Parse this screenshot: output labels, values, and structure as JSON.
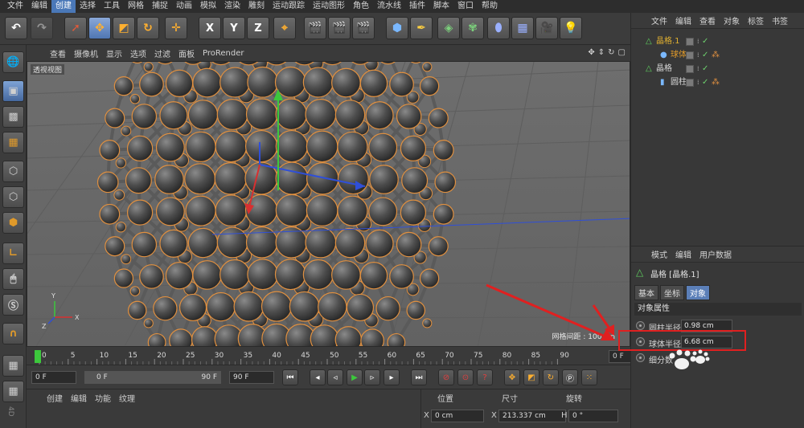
{
  "menubar": [
    "文件",
    "编辑",
    "创建",
    "选择",
    "工具",
    "网格",
    "捕捉",
    "动画",
    "模拟",
    "渲染",
    "雕刻",
    "运动跟踪",
    "运动图形",
    "角色",
    "流水线",
    "插件",
    "脚本",
    "窗口",
    "帮助"
  ],
  "menubar_active_index": 2,
  "toolbar": {
    "x_label": "X",
    "y_label": "Y",
    "z_label": "Z"
  },
  "viewport": {
    "menu": [
      "查看",
      "摄像机",
      "显示",
      "选项",
      "过滤",
      "面板",
      "ProRender"
    ],
    "view_label": "透视视图",
    "grid_info": "网格间距 : 100 cm"
  },
  "timeline": {
    "ticks": [
      "0",
      "5",
      "10",
      "15",
      "20",
      "25",
      "30",
      "35",
      "40",
      "45",
      "50",
      "55",
      "60",
      "65",
      "70",
      "75",
      "80",
      "85",
      "90"
    ],
    "current_frame": "0 F"
  },
  "playback": {
    "start": "0 F",
    "range_start": "0 F",
    "range_end": "90 F",
    "end": "90 F"
  },
  "bottom_tabs": [
    "创建",
    "编辑",
    "功能",
    "纹理"
  ],
  "coords": {
    "headers": [
      "位置",
      "尺寸",
      "旋转"
    ],
    "x_label": "X",
    "x_value": "0 cm",
    "size_label": "X",
    "size_value": "213.337 cm",
    "h_label": "H",
    "h_value": "0 °"
  },
  "object_manager": {
    "menu": [
      "文件",
      "编辑",
      "查看",
      "对象",
      "标签",
      "书签"
    ],
    "objects": [
      {
        "name": "晶格.1",
        "color": "#e0b030"
      },
      {
        "name": "球体",
        "color": "#e09a2a"
      },
      {
        "name": "晶格",
        "color": "#d8d8d8"
      },
      {
        "name": "圆柱",
        "color": "#d8d8d8"
      }
    ]
  },
  "attribute_manager": {
    "menu": [
      "模式",
      "编辑",
      "用户数据"
    ],
    "title": "晶格 [晶格.1]",
    "tabs": [
      "基本",
      "坐标",
      "对象"
    ],
    "section": "对象属性",
    "fields": [
      {
        "label": "圆柱半径",
        "value": "0.98 cm"
      },
      {
        "label": "球体半径",
        "value": "6.68 cm"
      },
      {
        "label": "细分数",
        "value": ""
      }
    ]
  },
  "colors": {
    "highlight": "#e02020",
    "accent": "#4a78b8",
    "sphere": "#5a5a5a",
    "outline": "#e09040"
  }
}
